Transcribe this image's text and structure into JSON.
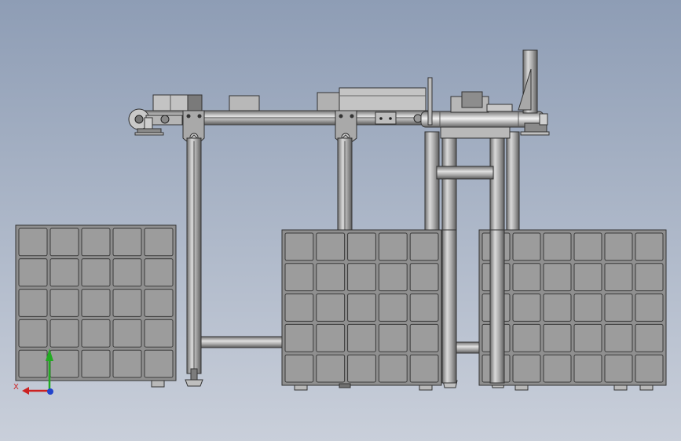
{
  "viewport": {
    "background_top": "#8e9db5",
    "background_bottom": "#c9cfda"
  },
  "colors": {
    "frame_face": "#9a9a9a",
    "frame_dark": "#5a5a5a",
    "frame_light": "#d2d2d2",
    "bin_fill": "#8f8f8f",
    "bin_cell": "#9c9c9c",
    "bin_line": "#3a3a3a",
    "axis_x": "#cc2222",
    "axis_y": "#22aa22",
    "axis_z": "#2244cc"
  },
  "model": {
    "bins": [
      {
        "name": "left-parts-bin",
        "rows": 5,
        "cols": 5
      },
      {
        "name": "center-parts-bin",
        "rows": 5,
        "cols": 5
      },
      {
        "name": "right-parts-bin",
        "rows": 5,
        "cols": 6
      }
    ]
  },
  "triad": {
    "x_label": "X",
    "icon": "coordinate-triad-icon"
  }
}
